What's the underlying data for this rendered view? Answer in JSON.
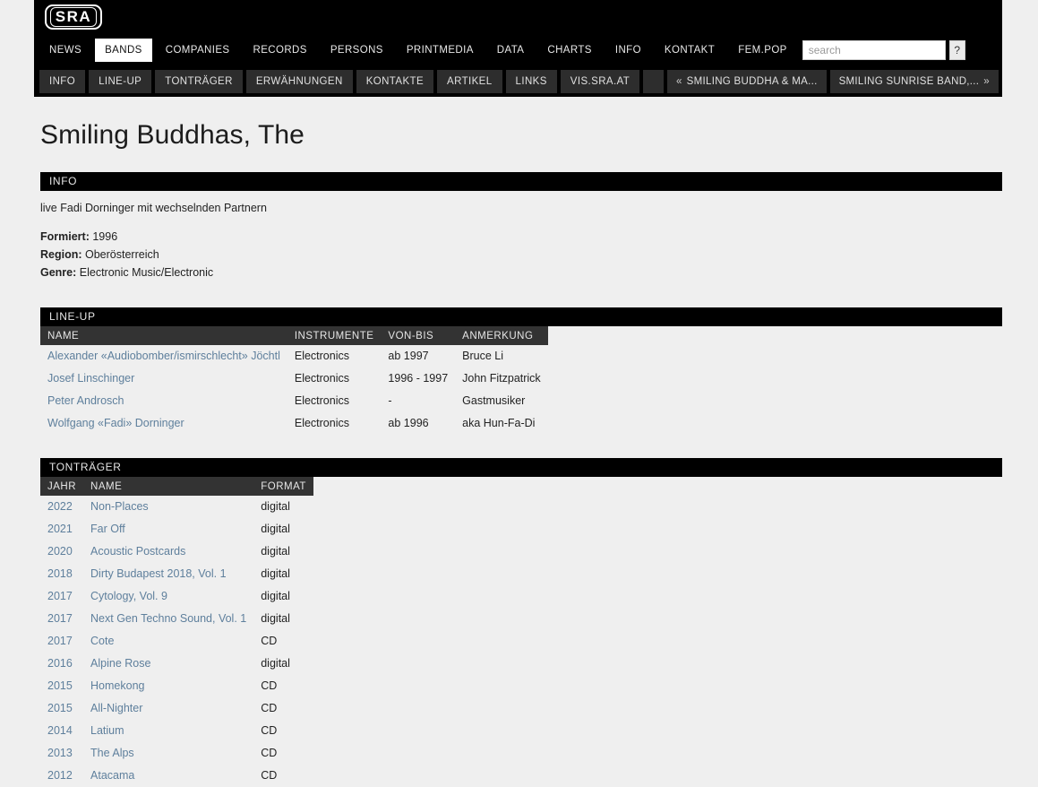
{
  "brand": {
    "logo_text": "SRA"
  },
  "mainnav": {
    "items": [
      {
        "label": "NEWS",
        "active": false
      },
      {
        "label": "BANDS",
        "active": true
      },
      {
        "label": "COMPANIES",
        "active": false
      },
      {
        "label": "RECORDS",
        "active": false
      },
      {
        "label": "PERSONS",
        "active": false
      },
      {
        "label": "PRINTMEDIA",
        "active": false
      },
      {
        "label": "DATA",
        "active": false
      },
      {
        "label": "CHARTS",
        "active": false
      },
      {
        "label": "INFO",
        "active": false
      },
      {
        "label": "KONTAKT",
        "active": false
      },
      {
        "label": "FEM.POP",
        "active": false
      }
    ]
  },
  "search": {
    "value": "",
    "placeholder": "search",
    "help_label": "?"
  },
  "subnav": {
    "items": [
      {
        "label": "INFO"
      },
      {
        "label": "LINE-UP"
      },
      {
        "label": "TONTRÄGER"
      },
      {
        "label": "ERWÄHNUNGEN"
      },
      {
        "label": "KONTAKTE"
      },
      {
        "label": "ARTIKEL"
      },
      {
        "label": "LINKS"
      },
      {
        "label": "VIS.SRA.AT"
      }
    ],
    "pager": {
      "prev_arrow": "«",
      "prev_label": "SMILING BUDDHA & MA...",
      "next_label": "SMILING SUNRISE BAND,...",
      "next_arrow": "»"
    }
  },
  "page": {
    "title": "Smiling Buddhas, The"
  },
  "info": {
    "header": "INFO",
    "description": "live Fadi Dorninger mit wechselnden Partnern",
    "fields": [
      {
        "label": "Formiert:",
        "value": "1996"
      },
      {
        "label": "Region:",
        "value": "Oberösterreich"
      },
      {
        "label": "Genre:",
        "value": "Electronic Music/Electronic"
      }
    ]
  },
  "lineup": {
    "header": "LINE-UP",
    "columns": [
      "NAME",
      "INSTRUMENTE",
      "VON-BIS",
      "ANMERKUNG"
    ],
    "rows": [
      {
        "name": "Alexander «Audiobomber/ismirschlecht» Jöchtl",
        "instrumente": "Electronics",
        "von_bis": "ab 1997",
        "anmerkung": "Bruce Li"
      },
      {
        "name": "Josef Linschinger",
        "instrumente": "Electronics",
        "von_bis": "1996 - 1997",
        "anmerkung": "John Fitzpatrick"
      },
      {
        "name": "Peter Androsch",
        "instrumente": "Electronics",
        "von_bis": "-",
        "anmerkung": "Gastmusiker"
      },
      {
        "name": "Wolfgang «Fadi» Dorninger",
        "instrumente": "Electronics",
        "von_bis": "ab 1996",
        "anmerkung": "aka Hun-Fa-Di"
      }
    ]
  },
  "tontraeger": {
    "header": "TONTRÄGER",
    "columns": [
      "JAHR",
      "NAME",
      "FORMAT"
    ],
    "rows": [
      {
        "jahr": "2022",
        "name": "Non-Places",
        "format": "digital"
      },
      {
        "jahr": "2021",
        "name": "Far Off",
        "format": "digital"
      },
      {
        "jahr": "2020",
        "name": "Acoustic Postcards",
        "format": "digital"
      },
      {
        "jahr": "2018",
        "name": "Dirty Budapest 2018, Vol. 1",
        "format": "digital"
      },
      {
        "jahr": "2017",
        "name": "Cytology, Vol. 9",
        "format": "digital"
      },
      {
        "jahr": "2017",
        "name": "Next Gen Techno Sound, Vol. 1",
        "format": "digital"
      },
      {
        "jahr": "2017",
        "name": "Cote",
        "format": "CD"
      },
      {
        "jahr": "2016",
        "name": "Alpine Rose",
        "format": "digital"
      },
      {
        "jahr": "2015",
        "name": "Homekong",
        "format": "CD"
      },
      {
        "jahr": "2015",
        "name": "All-Nighter",
        "format": "CD"
      },
      {
        "jahr": "2014",
        "name": "Latium",
        "format": "CD"
      },
      {
        "jahr": "2013",
        "name": "The Alps",
        "format": "CD"
      },
      {
        "jahr": "2012",
        "name": "Atacama",
        "format": "CD"
      }
    ]
  },
  "colors": {
    "header_bg": "#000000",
    "subnav_button": "#2d2d2d",
    "table_header": "#333333",
    "link": "#5e7f9c",
    "page_bg": "#efefef"
  }
}
